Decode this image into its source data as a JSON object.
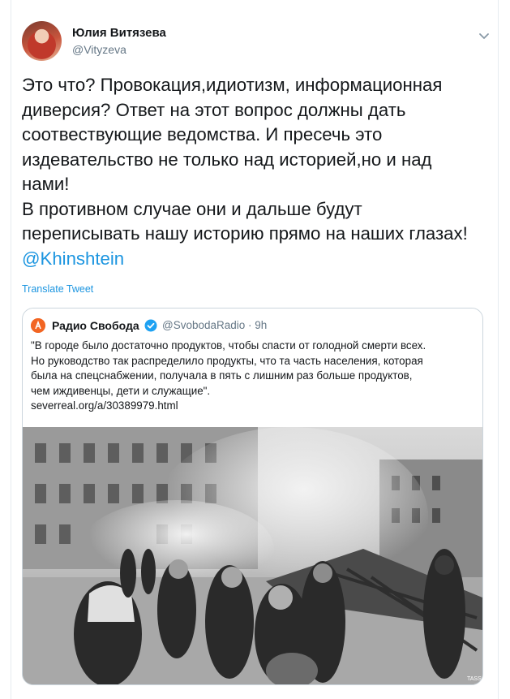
{
  "tweet": {
    "author_name": "Юлия Витязева",
    "author_handle": "@Vityzeva",
    "text_lines": [
      "Это что? Провокация,идиотизм, информационная",
      "диверсия? Ответ на этот вопрос должны дать",
      "соотвествующие ведомства. И пресечь это",
      "издевательство не только над историей,но и над",
      "нами!",
      "В противном случае они и дальше будут",
      "переписывать нашу историю прямо на наших глазах!"
    ],
    "mention": "@Khinshtein",
    "translate_label": "Translate Tweet"
  },
  "quote": {
    "author_name": "Радио Свобода",
    "author_handle": "@SvobodaRadio",
    "time": "9h",
    "text_lines": [
      "\"В городе было достаточно продуктов, чтобы спасти от голодной смерти всех.",
      "Но руководство так распределило продукты, что та часть населения, которая",
      "была на спецснабжении, получала в пять с лишним раз больше продуктов,",
      "чем иждивенцы, дети и служащие\".",
      "severreal.org/a/30389979.html"
    ],
    "photo_watermark": "TASS"
  },
  "icons": {
    "caret": "chevron-down-icon",
    "verified": "verified-badge-icon",
    "logo": "radio-svoboda-logo-icon"
  },
  "colors": {
    "link": "#1b95e0",
    "secondary_text": "#657786",
    "border": "#ccd6dd"
  }
}
